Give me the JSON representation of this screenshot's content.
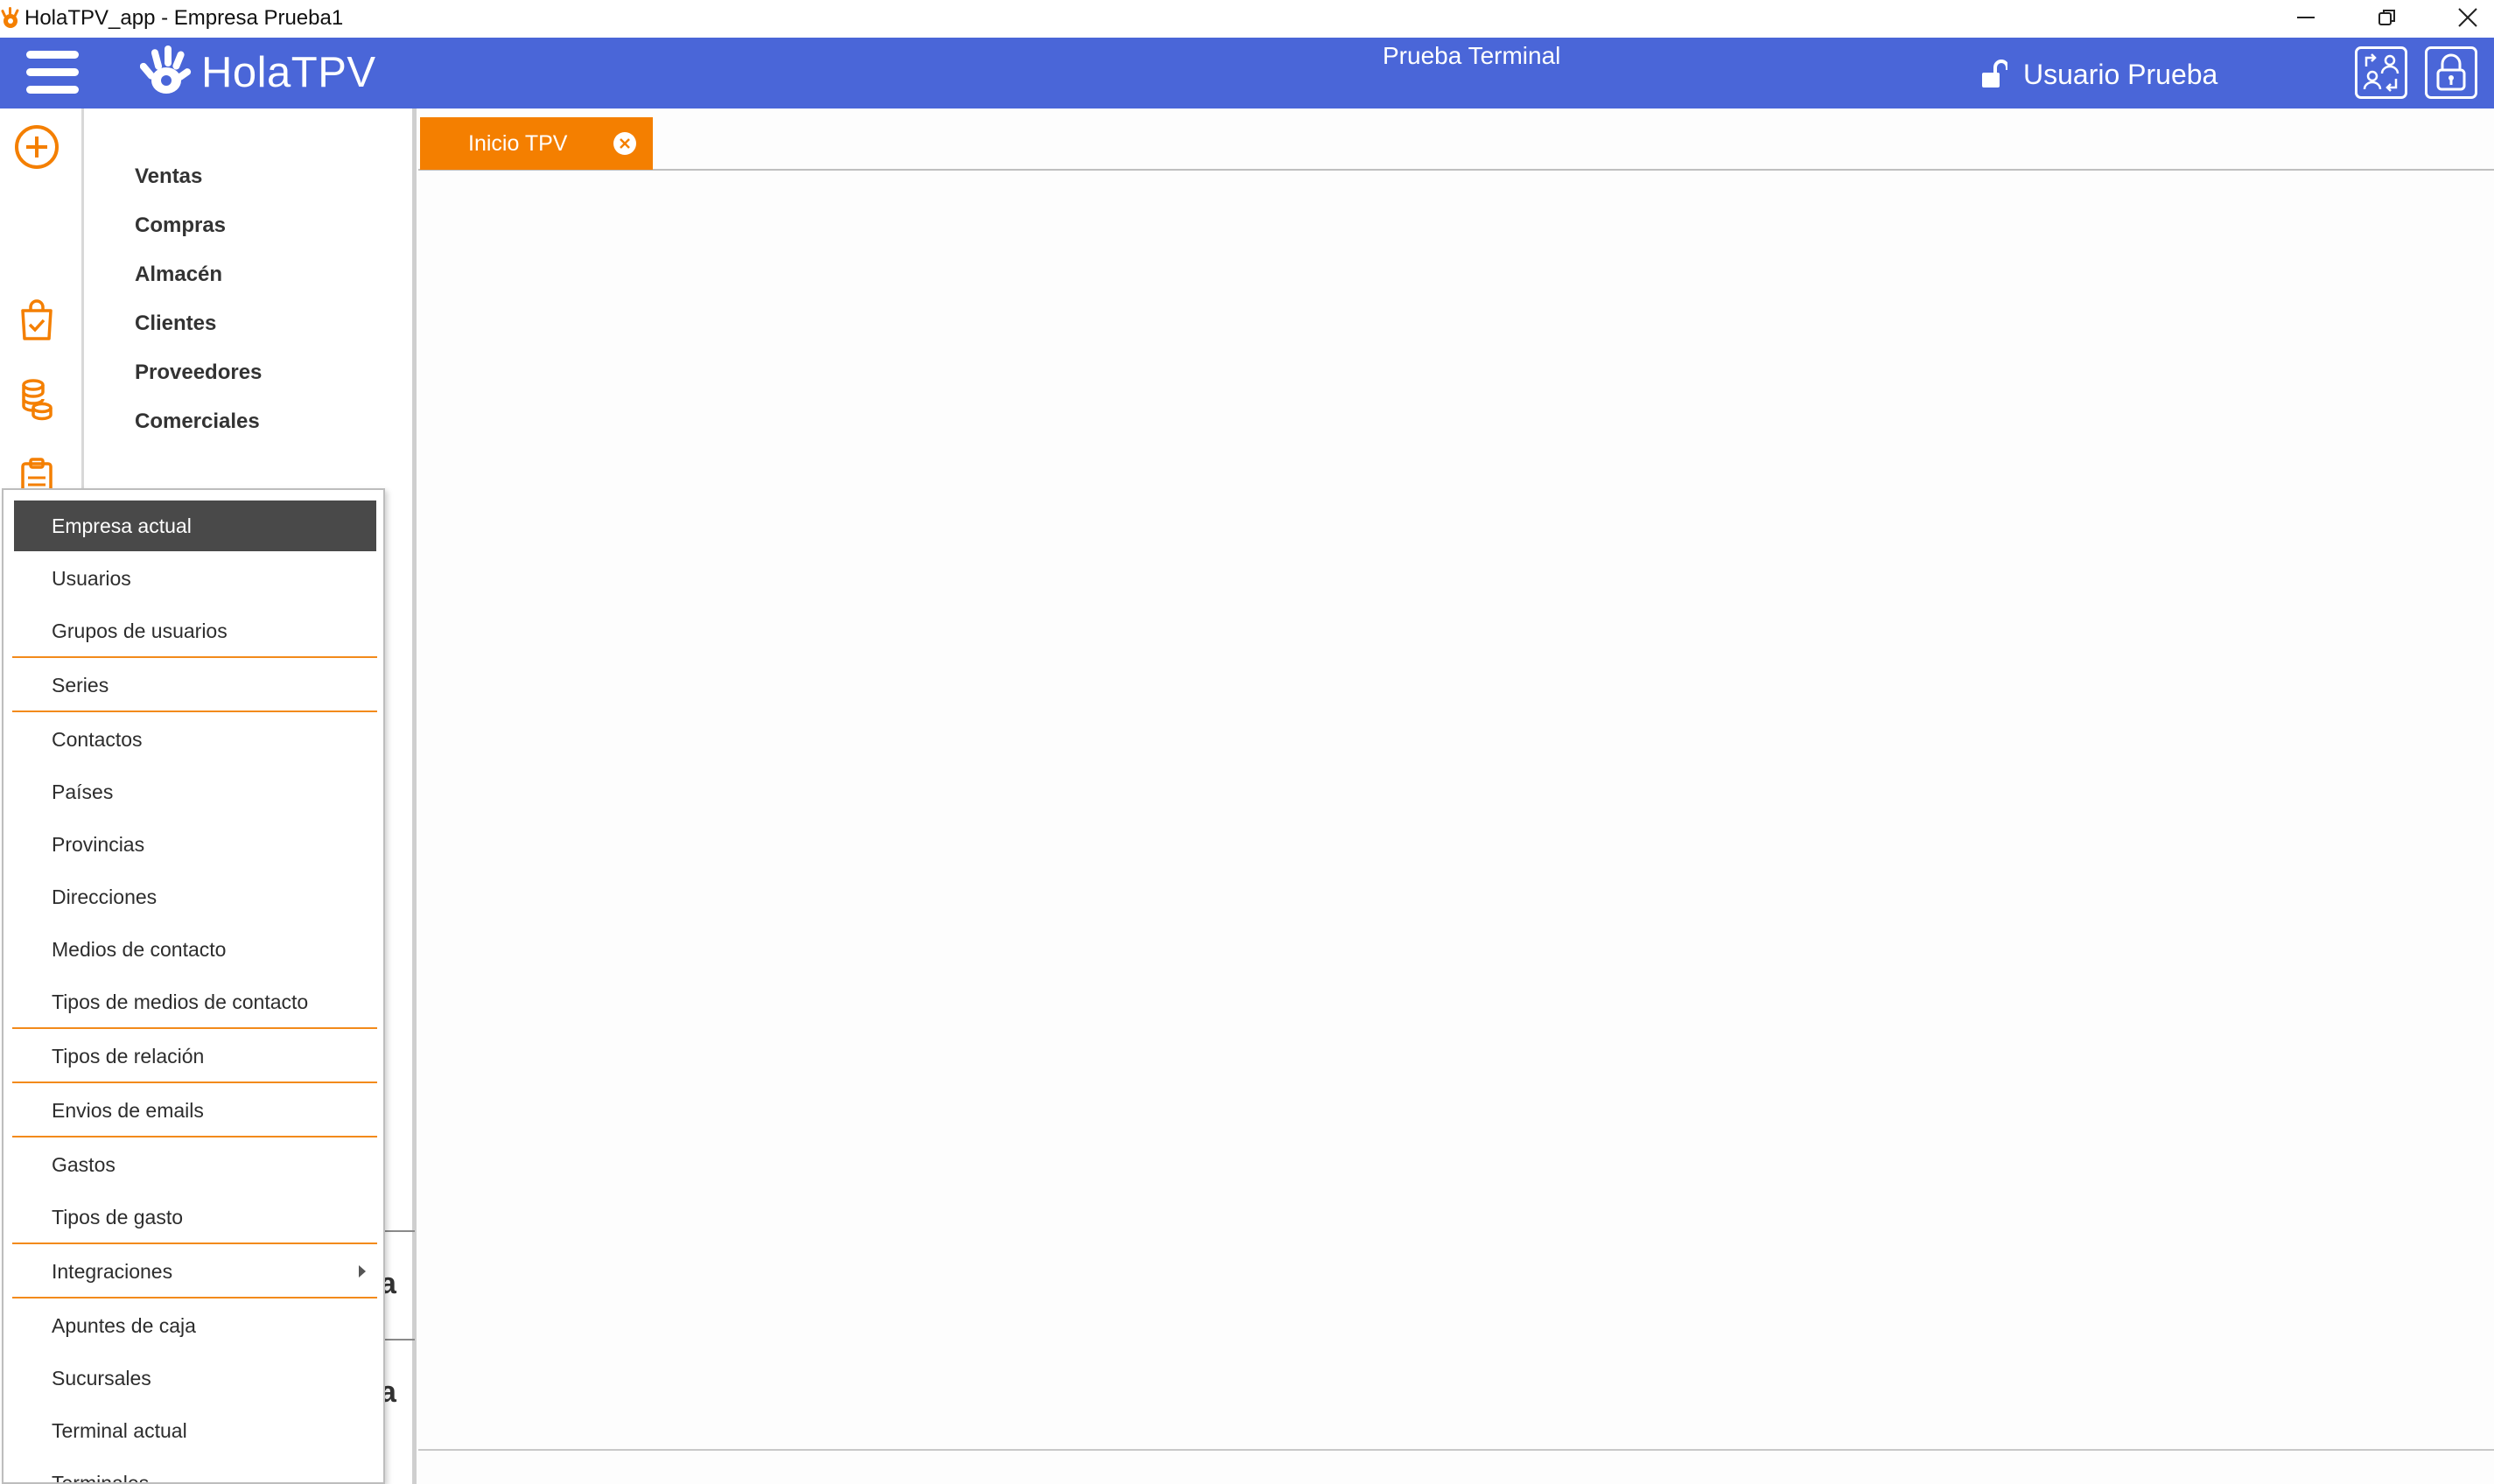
{
  "window": {
    "title": "HolaTPV_app - Empresa Prueba1",
    "icon": "holatpv-hand-icon",
    "controls": [
      "minimize-icon",
      "restore-icon",
      "close-icon"
    ]
  },
  "header": {
    "menu_icon": "hamburger-icon",
    "logo_text": "HolaTPV",
    "terminal_label": "Prueba Terminal",
    "user_icon": "unlocked-padlock-icon",
    "user_name": "Usuario Prueba",
    "buttons": [
      "switch-user-icon",
      "lock-icon"
    ],
    "colors": {
      "bar": "#4a66d8",
      "text": "#ffffff"
    }
  },
  "rail": {
    "icons": [
      "add-circle-icon",
      "shopping-bag-icon",
      "coins-stack-icon",
      "clipboard-icon"
    ],
    "accent": "#f47f00"
  },
  "sidebar": {
    "items": [
      "Ventas",
      "Compras",
      "Almacén",
      "Clientes",
      "Proveedores",
      "Comerciales"
    ],
    "cut_off_text": [
      "a",
      "a"
    ]
  },
  "tabs": [
    {
      "label": "Inicio TPV",
      "close_icon": "close-circle-icon",
      "active": true
    }
  ],
  "menu": {
    "items": [
      {
        "label": "Empresa actual",
        "active": true
      },
      {
        "label": "Usuarios"
      },
      {
        "label": "Grupos de usuarios"
      },
      {
        "label": "Series"
      },
      {
        "label": "Contactos"
      },
      {
        "label": "Países"
      },
      {
        "label": "Provincias"
      },
      {
        "label": "Direcciones"
      },
      {
        "label": "Medios de contacto"
      },
      {
        "label": "Tipos de medios de contacto"
      },
      {
        "label": "Tipos de relación"
      },
      {
        "label": "Envios de emails"
      },
      {
        "label": "Gastos"
      },
      {
        "label": "Tipos de gasto"
      },
      {
        "label": "Integraciones",
        "submenu": true
      },
      {
        "label": "Apuntes de caja"
      },
      {
        "label": "Sucursales"
      },
      {
        "label": "Terminal actual"
      },
      {
        "label": "Terminales"
      }
    ],
    "colors": {
      "separator": "#f28a1b",
      "active_bg": "#494949"
    }
  }
}
